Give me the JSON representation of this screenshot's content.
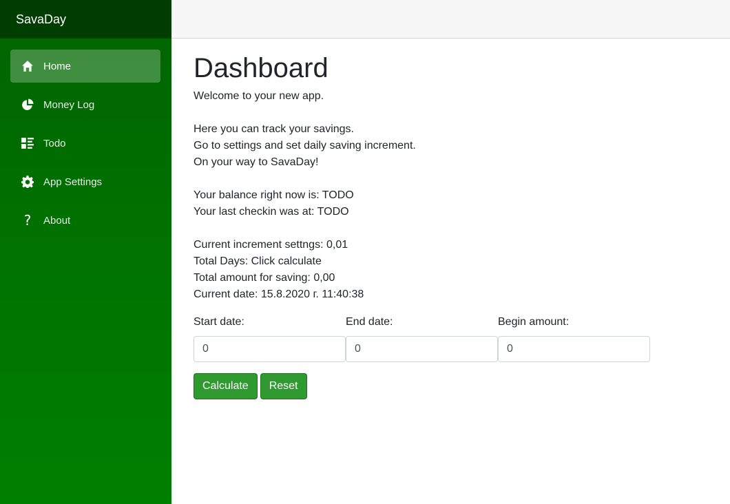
{
  "app": {
    "brand": "SavaDay"
  },
  "sidebar": {
    "items": [
      {
        "label": "Home",
        "icon": "home-icon",
        "active": true
      },
      {
        "label": "Money Log",
        "icon": "pie-chart-icon"
      },
      {
        "label": "Todo",
        "icon": "list-icon"
      },
      {
        "label": "App Settings",
        "icon": "gear-icon"
      },
      {
        "label": "About",
        "icon": "question-icon"
      }
    ]
  },
  "main": {
    "title": "Dashboard",
    "welcome": "Welcome to your new app.",
    "intro": [
      "Here you can track your savings.",
      "Go to settings and set daily saving increment.",
      "On your way to SavaDay!"
    ],
    "status": [
      "Your balance right now is: TODO",
      "Your last checkin was at: TODO"
    ],
    "settings": [
      "Current increment settngs: 0,01",
      "Total Days: Click calculate",
      "Total amount for saving: 0,00",
      "Current date: 15.8.2020 г. 11:40:38"
    ],
    "form": {
      "start_label": "Start date:",
      "start_value": "0",
      "end_label": "End date:",
      "end_value": "0",
      "begin_label": "Begin amount:",
      "begin_value": "0"
    },
    "buttons": {
      "calculate": "Calculate",
      "reset": "Reset"
    }
  },
  "colors": {
    "sidebar_top": "#006400",
    "sidebar_bottom": "#008000",
    "brand_bg": "#003d00",
    "button": "#2f9a2f"
  }
}
